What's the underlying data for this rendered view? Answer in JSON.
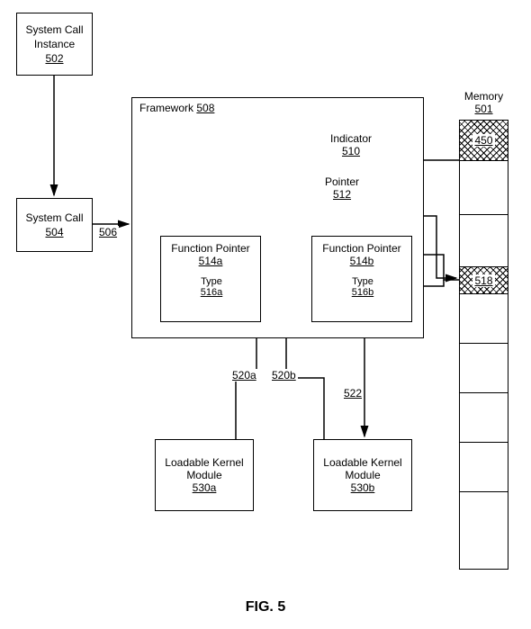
{
  "fig_label": "FIG. 5",
  "sci": {
    "title": "System Call Instance",
    "num": "502"
  },
  "sc": {
    "title": "System Call",
    "num": "504"
  },
  "edge_506": "506",
  "framework": {
    "title": "Framework",
    "num": "508"
  },
  "indicator": {
    "title": "Indicator",
    "num": "510"
  },
  "pointer": {
    "title": "Pointer",
    "num": "512"
  },
  "fpa": {
    "title": "Function Pointer",
    "num": "514a",
    "type_label": "Type",
    "type_num": "516a"
  },
  "fpb": {
    "title": "Function Pointer",
    "num": "514b",
    "type_label": "Type",
    "type_num": "516b"
  },
  "memory": {
    "title": "Memory",
    "num": "501",
    "cell_450": "450",
    "cell_518": "518"
  },
  "edge_520a": "520a",
  "edge_520b": "520b",
  "edge_522": "522",
  "lkm_a": {
    "title": "Loadable Kernel Module",
    "num": "530a"
  },
  "lkm_b": {
    "title": "Loadable Kernel Module",
    "num": "530b"
  }
}
